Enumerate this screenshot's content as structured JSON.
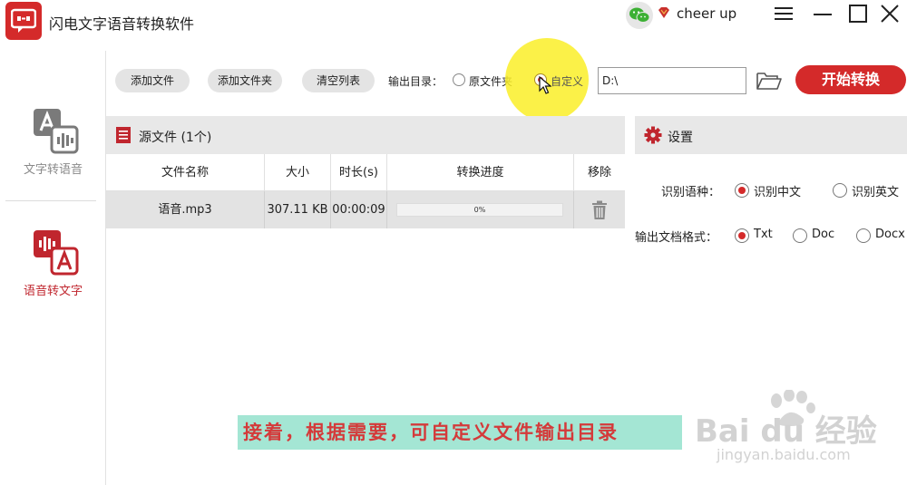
{
  "app": {
    "title": "闪电文字语音转换软件",
    "username": "cheer up"
  },
  "nav": {
    "tts_label": "文字转语音",
    "stt_label": "语音转文字",
    "active": "stt"
  },
  "toolbar": {
    "add_file": "添加文件",
    "add_folder": "添加文件夹",
    "clear_list": "清空列表",
    "output_label": "输出目录：",
    "option_original": "原文件夹",
    "option_custom": "自定义",
    "selected_option": "custom",
    "path_value": "D:\\",
    "start_button": "开始转换"
  },
  "files": {
    "header": "源文件 (1个)",
    "columns": [
      "文件名称",
      "大小",
      "时长(s)",
      "转换进度",
      "移除"
    ],
    "rows": [
      {
        "name": "语音.mp3",
        "size": "307.11 KB",
        "duration": "00:00:09",
        "progress": 0,
        "progress_text": "0%"
      }
    ]
  },
  "settings": {
    "header": "设置",
    "lang_label": "识别语种：",
    "lang_options": [
      "识别中文",
      "识别英文"
    ],
    "lang_selected": 0,
    "format_label": "输出文档格式：",
    "format_options": [
      "Txt",
      "Doc",
      "Docx"
    ],
    "format_selected": 0
  },
  "caption": "接着，根据需要，可自定义文件输出目录",
  "watermark": {
    "brand": "Bai du 经验",
    "url": "jingyan.baidu.com"
  },
  "colors": {
    "accent": "#d42a2a",
    "caption_bg": "#a4e6d4",
    "caption_text": "#d43a3a"
  }
}
